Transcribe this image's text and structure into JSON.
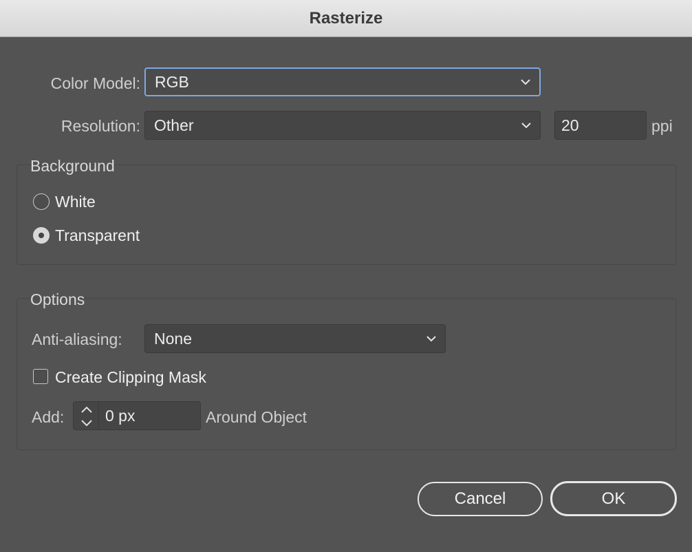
{
  "window": {
    "title": "Rasterize"
  },
  "color_model": {
    "label": "Color Model:",
    "value": "RGB"
  },
  "resolution": {
    "label": "Resolution:",
    "value": "Other",
    "ppi_value": "20",
    "unit": "ppi"
  },
  "background": {
    "title": "Background",
    "options": [
      {
        "label": "White",
        "selected": false
      },
      {
        "label": "Transparent",
        "selected": true
      }
    ]
  },
  "options": {
    "title": "Options",
    "anti_aliasing": {
      "label": "Anti-aliasing:",
      "value": "None"
    },
    "clipping_mask": {
      "label": "Create Clipping Mask",
      "checked": false
    },
    "add": {
      "label": "Add:",
      "value": "0 px",
      "suffix": "Around Object"
    }
  },
  "buttons": {
    "cancel": "Cancel",
    "ok": "OK"
  },
  "colors": {
    "focus_ring": "#7ea8e6",
    "dialog_bg": "#535353",
    "field_bg": "#454545"
  },
  "icons": [
    "chevron-down-icon",
    "stepper-icon",
    "radio-icon",
    "checkbox-icon"
  ]
}
